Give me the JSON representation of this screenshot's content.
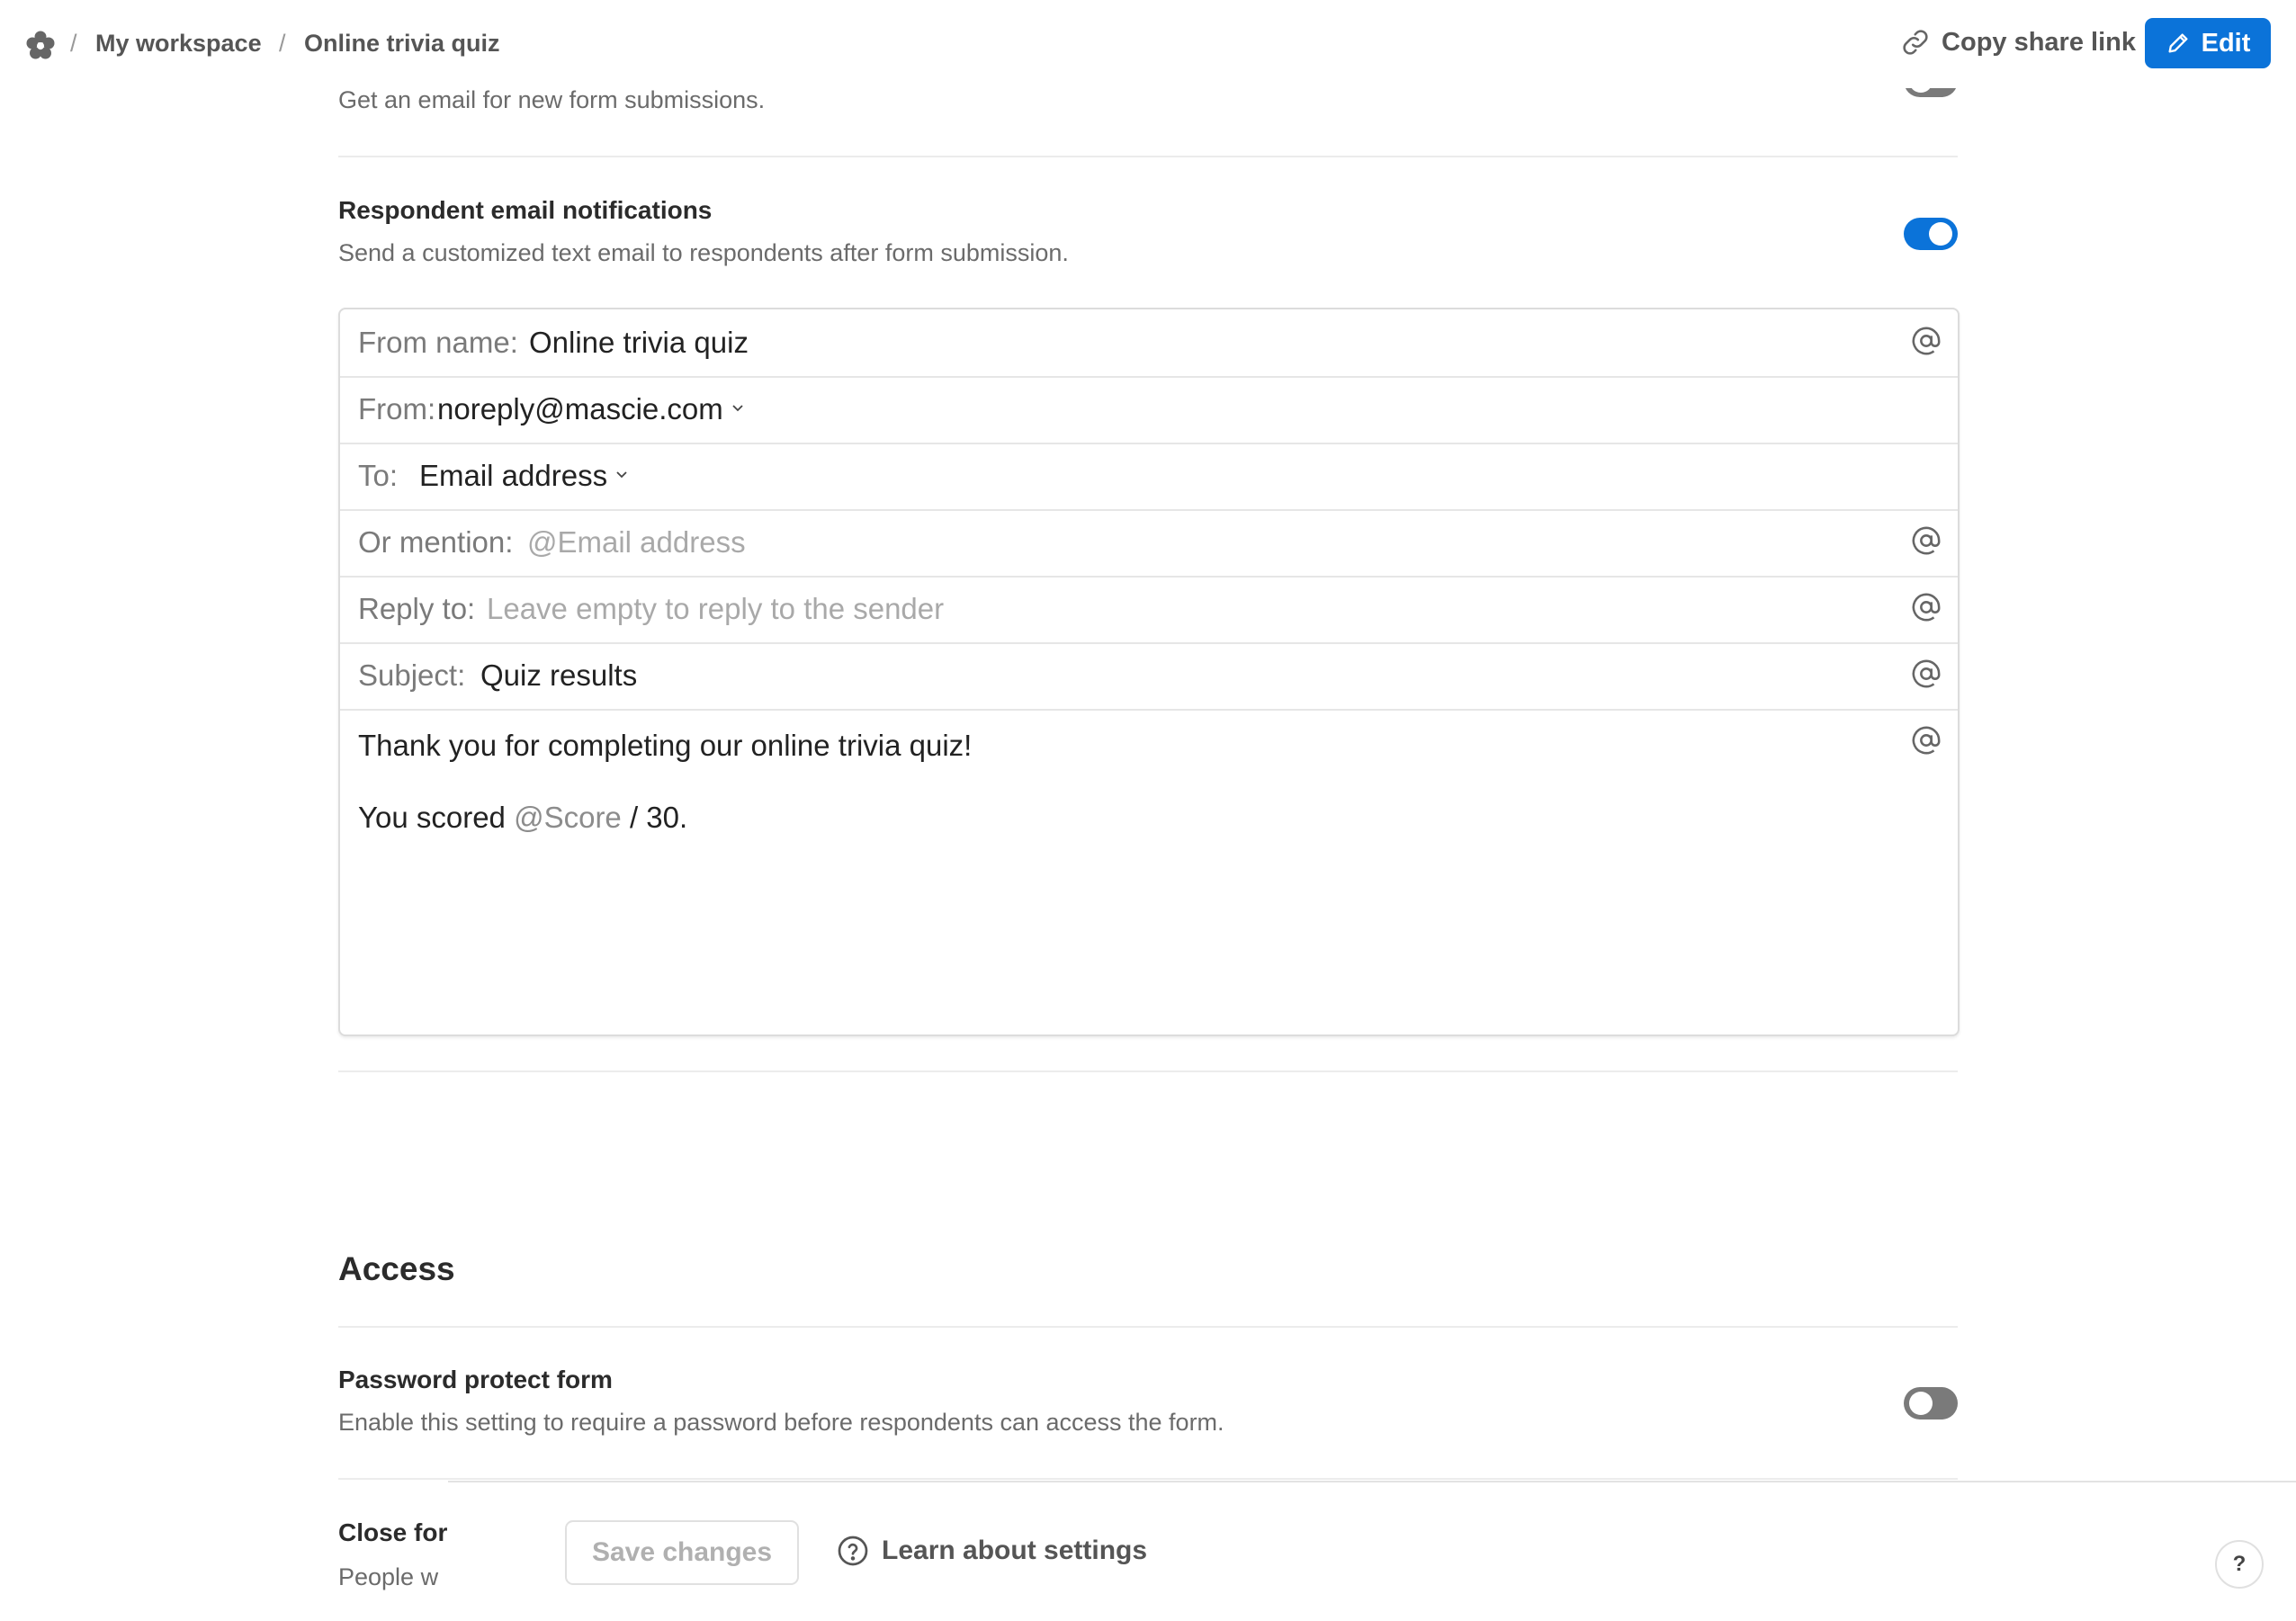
{
  "breadcrumb": {
    "workspace": "My workspace",
    "form": "Online trivia quiz",
    "separator": "/"
  },
  "toolbar": {
    "copy_share_link": "Copy share link",
    "edit": "Edit"
  },
  "settings": {
    "owner_notifications": {
      "description": "Get an email for new form submissions.",
      "enabled": false
    },
    "respondent_notifications": {
      "title": "Respondent email notifications",
      "description": "Send a customized text email to respondents after form submission.",
      "enabled": true
    },
    "email": {
      "from_name_label": "From name:",
      "from_name_value": "Online trivia quiz",
      "from_label": "From:",
      "from_value": "noreply@mascie.com",
      "to_label": "To:",
      "to_value": "Email address",
      "mention_label": "Or mention:",
      "mention_placeholder": "@Email address",
      "reply_label": "Reply to:",
      "reply_placeholder": "Leave empty to reply to the sender",
      "subject_label": "Subject:",
      "subject_value": "Quiz results",
      "body_line1": "Thank you for completing our online trivia quiz!",
      "body_line2_prefix": "You scored",
      "body_line2_mention": "@Score",
      "body_line2_suffix": "/ 30."
    },
    "access": {
      "heading": "Access",
      "password": {
        "title": "Password protect form",
        "description": "Enable this setting to require a password before respondents can access the form.",
        "enabled": false
      },
      "close_form": {
        "title": "Close for",
        "description": "People w"
      }
    }
  },
  "footer": {
    "save_changes": "Save changes",
    "learn_about_settings": "Learn about settings",
    "help": "?"
  },
  "colors": {
    "accent": "#0b73d9",
    "toggle_off": "#7a7a7a"
  }
}
